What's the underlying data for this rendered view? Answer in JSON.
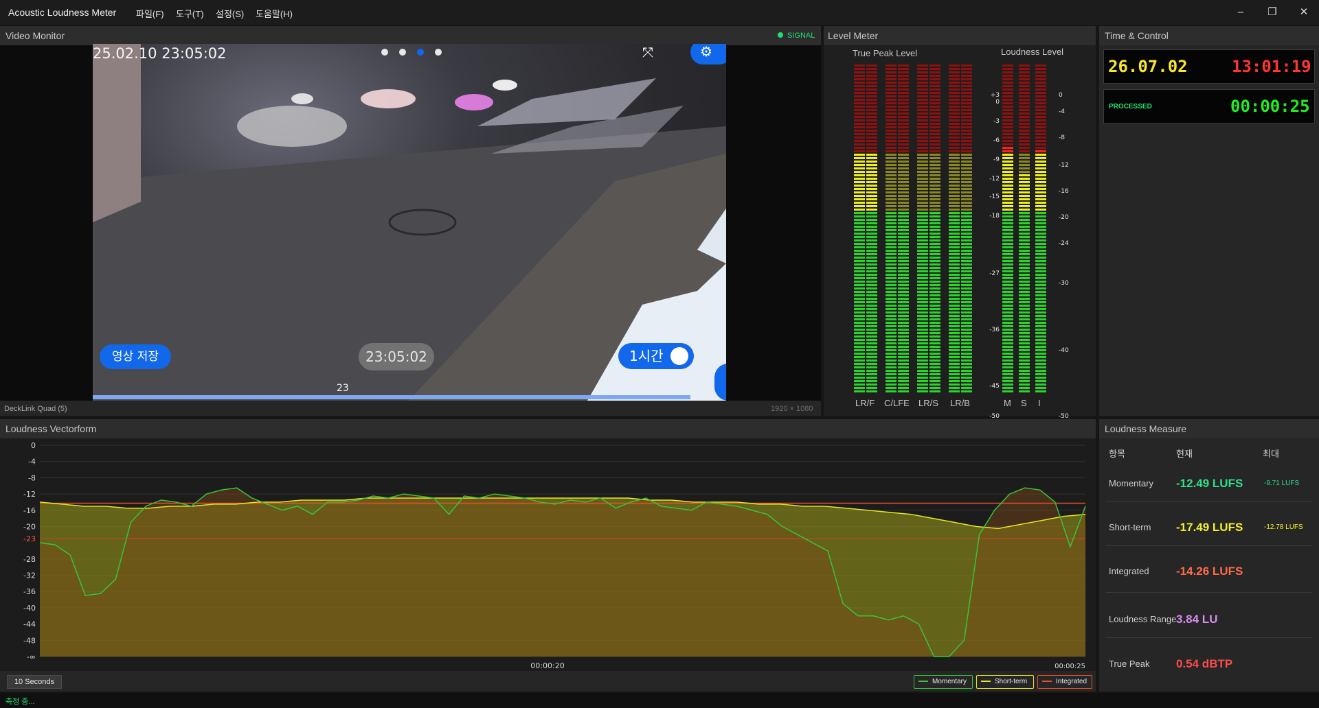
{
  "app": {
    "title": "Acoustic Loudness Meter",
    "menu": [
      "파일(F)",
      "도구(T)",
      "설정(S)",
      "도움말(H)"
    ],
    "window_controls": {
      "minimize": "–",
      "restore": "❐",
      "close": "✕"
    }
  },
  "video_monitor": {
    "title": "Video Monitor",
    "signal_label": "SIGNAL",
    "device": "DeckLink Quad (5)",
    "resolution": "1920 × 1080",
    "overlay": {
      "datetime": "25.02.10  23:05:02",
      "save_button": "영상 저장",
      "time_pill": "23:05:02",
      "duration_toggle": "1시간",
      "scrub_label": "23"
    }
  },
  "level_meter": {
    "title": "Level Meter",
    "true_peak_title": "True Peak Level",
    "loudness_title": "Loudness Level",
    "tp_scale": [
      "+3",
      "0",
      "-3",
      "-6",
      "-9",
      "-12",
      "-15",
      "-18",
      "-27",
      "-36",
      "-45",
      "-50"
    ],
    "ld_scale": [
      "0",
      "-4",
      "-8",
      "-12",
      "-16",
      "-20",
      "-24",
      "-30",
      "-40",
      "-50"
    ],
    "tp_channels": [
      "LR/F",
      "C/LFE",
      "LR/S",
      "LR/B"
    ],
    "ld_channels": [
      "M",
      "S",
      "I"
    ]
  },
  "time_control": {
    "title": "Time & Control",
    "date": "26.07.02",
    "time": "13:01:19",
    "processed_label": "PROCESSED",
    "processed_time": "00:00:25"
  },
  "vectorform": {
    "title": "Loudness Vectorform",
    "time_labels": [
      "00:00:20",
      "00:00:25"
    ],
    "window_button": "10 Seconds",
    "legend": {
      "momentary": "Momentary",
      "short_term": "Short-term",
      "integrated": "Integrated"
    }
  },
  "loudness_measure": {
    "title": "Loudness Measure",
    "headers": {
      "item": "항목",
      "current": "현재",
      "max": "최대"
    },
    "momentary": {
      "label": "Momentary",
      "value": "-12.49 LUFS",
      "max": "-9.71 LUFS"
    },
    "short_term": {
      "label": "Short-term",
      "value": "-17.49 LUFS",
      "max": "-12.78 LUFS"
    },
    "integrated": {
      "label": "Integrated",
      "value": "-14.26 LUFS"
    },
    "range": {
      "label": "Loudness Range",
      "value": "3.84 LU"
    },
    "true_peak": {
      "label": "True Peak",
      "value": "0.54 dBTP"
    }
  },
  "status_bar": {
    "text": "측정 중..."
  },
  "colors": {
    "momentary": "#3ac43a",
    "short_term": "#e6e62a",
    "integrated": "#e8502a",
    "accent_blue": "#1268ea",
    "signal": "#20e070"
  },
  "chart_data": {
    "type": "area",
    "ylabels": [
      "0",
      "-4",
      "-8",
      "-12",
      "-16",
      "-20",
      "-23",
      "-28",
      "-32",
      "-36",
      "-40",
      "-44",
      "-48",
      "-∞"
    ],
    "ylim": [
      -52,
      0
    ],
    "x": [
      "00:00:20",
      "00:00:25"
    ],
    "reference_lines": {
      "target": -23,
      "integrated": -14.26
    },
    "series": [
      {
        "name": "Momentary",
        "values": [
          -24,
          -24.5,
          -27,
          -37,
          -36.5,
          -33,
          -19,
          -15,
          -13.5,
          -14,
          -15,
          -12,
          -11,
          -10.5,
          -13,
          -14.5,
          -16,
          -15,
          -17,
          -14,
          -14,
          -13.5,
          -12.5,
          -13,
          -12,
          -12.5,
          -13,
          -17,
          -12.5,
          -13,
          -12,
          -12.5,
          -13,
          -14,
          -14.5,
          -13.5,
          -14,
          -13,
          -15.5,
          -14,
          -13,
          -15,
          -15.5,
          -16,
          -14,
          -14.5,
          -15,
          -16,
          -17,
          -20,
          -22,
          -24,
          -26,
          -39,
          -42,
          -42,
          -43,
          -42,
          -44,
          -52,
          -52,
          -48,
          -22,
          -16,
          -12,
          -10.5,
          -11,
          -14,
          -25,
          -15
        ]
      },
      {
        "name": "Short-term",
        "values": [
          -14,
          -14.5,
          -15,
          -15,
          -15.5,
          -15.5,
          -15,
          -15,
          -14.5,
          -14.5,
          -14,
          -14,
          -13.5,
          -13.5,
          -13.5,
          -13,
          -13,
          -13,
          -13,
          -13,
          -13,
          -13,
          -13,
          -13,
          -13,
          -13,
          -13,
          -13,
          -13.5,
          -13.5,
          -14,
          -14,
          -14,
          -14.5,
          -14.5,
          -15,
          -15,
          -15.5,
          -16,
          -16.5,
          -17,
          -18,
          -19,
          -20,
          -20.5,
          -19.5,
          -18.5,
          -17.5,
          -17
        ]
      },
      {
        "name": "Integrated",
        "values": [
          -14.26
        ]
      }
    ]
  }
}
